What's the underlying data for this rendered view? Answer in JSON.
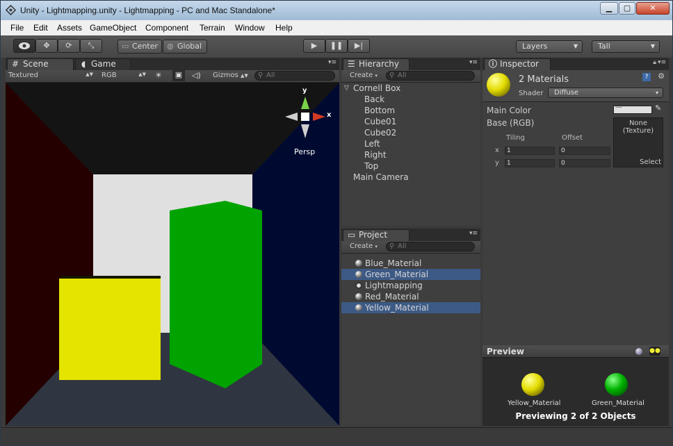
{
  "window": {
    "title": "Unity - Lightmapping.unity - Lightmapping - PC and Mac Standalone*"
  },
  "menu": [
    "File",
    "Edit",
    "Assets",
    "GameObject",
    "Component",
    "Terrain",
    "Window",
    "Help"
  ],
  "toolbar": {
    "center": "Center",
    "global": "Global",
    "layers": "Layers",
    "layout": "Tall"
  },
  "scene": {
    "tab_scene": "Scene",
    "tab_game": "Game",
    "render_mode": "Textured",
    "color_mode": "RGB",
    "gizmos": "Gizmos",
    "search": "All",
    "axis_y": "y",
    "axis_x": "x",
    "persp": "Persp",
    "colors": {
      "floor": "#2f3641",
      "left_wall": "#240000",
      "right_wall": "#000a30",
      "back_wall": "#e0e0e0",
      "ceiling": "#141414",
      "yellow": "#e5e300",
      "green": "#00a300"
    }
  },
  "hierarchy": {
    "tab": "Hierarchy",
    "create": "Create",
    "search": "All",
    "root": "Cornell Box",
    "children": [
      "Back",
      "Bottom",
      "Cube01",
      "Cube02",
      "Left",
      "Right",
      "Top"
    ],
    "camera": "Main Camera"
  },
  "project": {
    "tab": "Project",
    "create": "Create",
    "search": "All",
    "items": [
      {
        "label": "Blue_Material",
        "icon": "material-icon",
        "selected": false
      },
      {
        "label": "Green_Material",
        "icon": "material-icon",
        "selected": true
      },
      {
        "label": "Lightmapping",
        "icon": "unity-scene-icon",
        "selected": false
      },
      {
        "label": "Red_Material",
        "icon": "material-icon",
        "selected": false
      },
      {
        "label": "Yellow_Material",
        "icon": "material-icon",
        "selected": true
      }
    ]
  },
  "inspector": {
    "tab": "Inspector",
    "title": "2 Materials",
    "shader_label": "Shader",
    "shader_value": "Diffuse",
    "main_color": "Main Color",
    "base": "Base (RGB)",
    "tiling": "Tiling",
    "offset": "Offset",
    "x_label": "x",
    "y_label": "y",
    "tile_x": "1",
    "tile_y": "1",
    "off_x": "0",
    "off_y": "0",
    "texture_none": "None",
    "texture_kind": "(Texture)",
    "select": "Select"
  },
  "preview": {
    "title": "Preview",
    "items": [
      "Yellow_Material",
      "Green_Material"
    ],
    "status": "Previewing 2 of 2 Objects"
  }
}
